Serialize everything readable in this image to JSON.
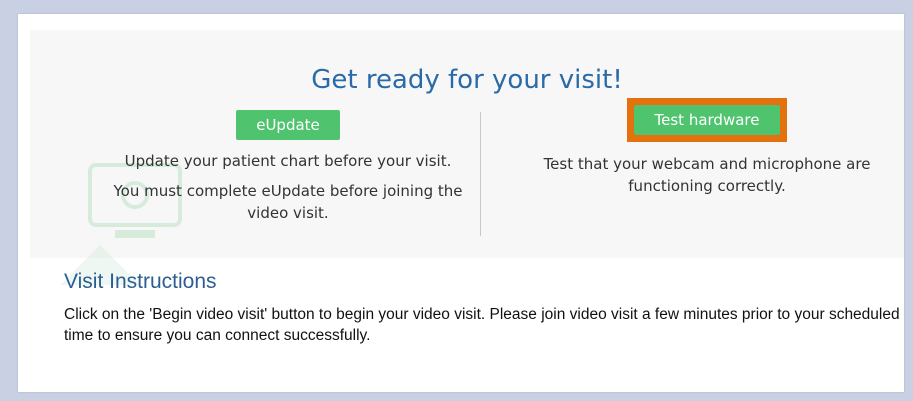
{
  "header": {
    "title": "Get ready for your visit!"
  },
  "eupdate": {
    "button_label": "eUpdate",
    "line1": "Update your patient chart before your visit.",
    "line2": "You must complete eUpdate before joining the video visit."
  },
  "test_hardware": {
    "button_label": "Test hardware",
    "description": "Test that your webcam and microphone are functioning correctly."
  },
  "instructions": {
    "title": "Visit Instructions",
    "text": "Click on the 'Begin video visit' button to begin your video visit. Please join video visit a few minutes prior to your scheduled time to ensure you can connect successfully."
  },
  "colors": {
    "title": "#2a6aa6",
    "button": "#4fc36e",
    "highlight": "#e3720e",
    "instructions_title": "#2b5f93"
  }
}
